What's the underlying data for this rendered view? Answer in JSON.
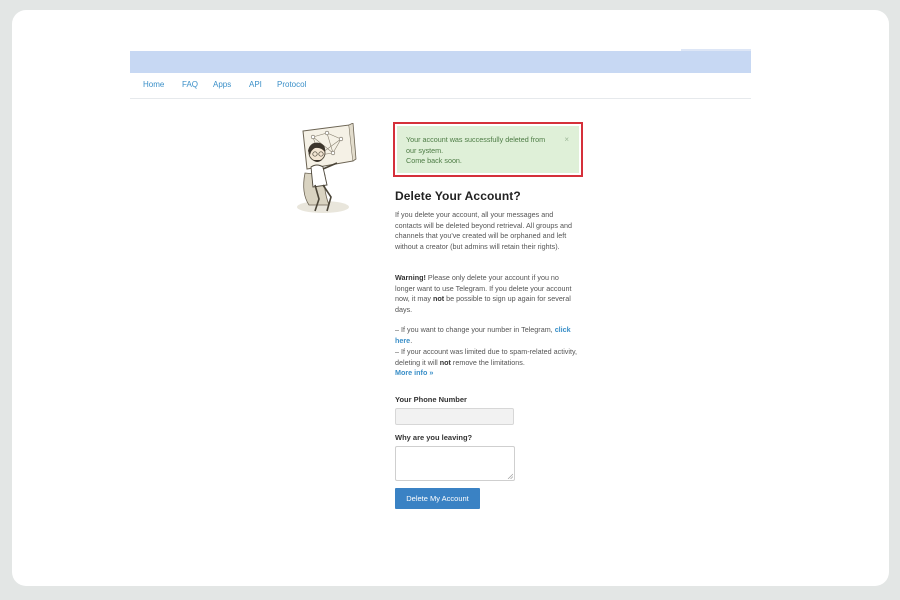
{
  "nav": {
    "items": [
      {
        "label": "Home"
      },
      {
        "label": "FAQ"
      },
      {
        "label": "Apps"
      },
      {
        "label": "API"
      },
      {
        "label": "Protocol"
      }
    ]
  },
  "alert": {
    "line1": "Your account was successfully deleted from",
    "line2": "our system.",
    "line3": "Come back soon.",
    "close_label": "×"
  },
  "main": {
    "title": "Delete Your Account?",
    "intro": "If you delete your account, all your messages and contacts will be deleted beyond retrieval. All groups and channels that you've created will be orphaned and left without a creator (but admins will retain their rights).",
    "warning_label": "Warning!",
    "warning_text_1": " Please only delete your account if you no longer want to use Telegram. If you delete your account now, it may ",
    "warning_not": "not",
    "warning_text_2": " be possible to sign up again for several days.",
    "change_number_text": "– If you want to change your number in Telegram, ",
    "change_number_link": "click here",
    "change_number_end": ".",
    "limited_text_1": "– If your account was limited due to spam-related activity, deleting it will ",
    "limited_not": "not",
    "limited_text_2": " remove the limitations.",
    "more_info_link": "More info »"
  },
  "form": {
    "phone_label": "Your Phone Number",
    "phone_value": "",
    "reason_label": "Why are you leaving?",
    "reason_value": "",
    "submit_label": "Delete My Account"
  },
  "colors": {
    "header_bar": "#c7d8f3",
    "link": "#3a8fc8",
    "alert_bg": "#dff0d8",
    "alert_border": "#d5303a",
    "button": "#3a82c4"
  }
}
